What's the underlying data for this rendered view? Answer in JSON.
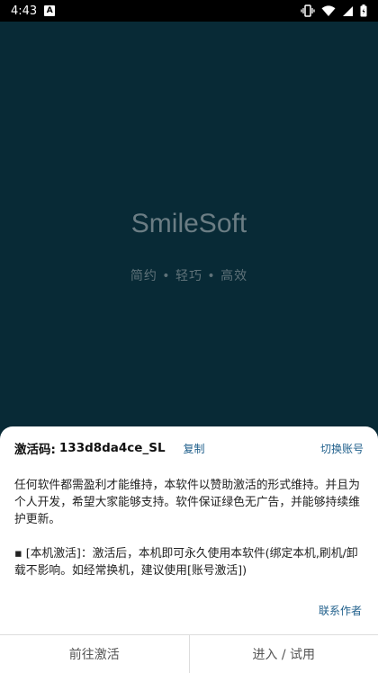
{
  "status_bar": {
    "time": "4:43",
    "notification_badge": "A"
  },
  "splash": {
    "app_name": "SmileSoft",
    "tagline": "简约 • 轻巧 • 高效"
  },
  "sheet": {
    "code_label": "激活码:",
    "code_value": "133d8da4ce_SL",
    "copy_label": "复制",
    "switch_account_label": "切换账号",
    "description": [
      "任何软件都需盈利才能维持，本软件以赞助激活的形式维持。并且为个人开发，希望大家能够支持。软件保证绿色无广告，并能够持续维护更新。",
      "▪ [本机激活]：激活后，本机即可永久使用本软件(绑定本机,刷机/卸载不影响。如经常换机，建议使用[账号激活])"
    ],
    "contact_label": "联系作者",
    "go_activate_label": "前往激活",
    "enter_trial_label": "进入 / 试用"
  }
}
